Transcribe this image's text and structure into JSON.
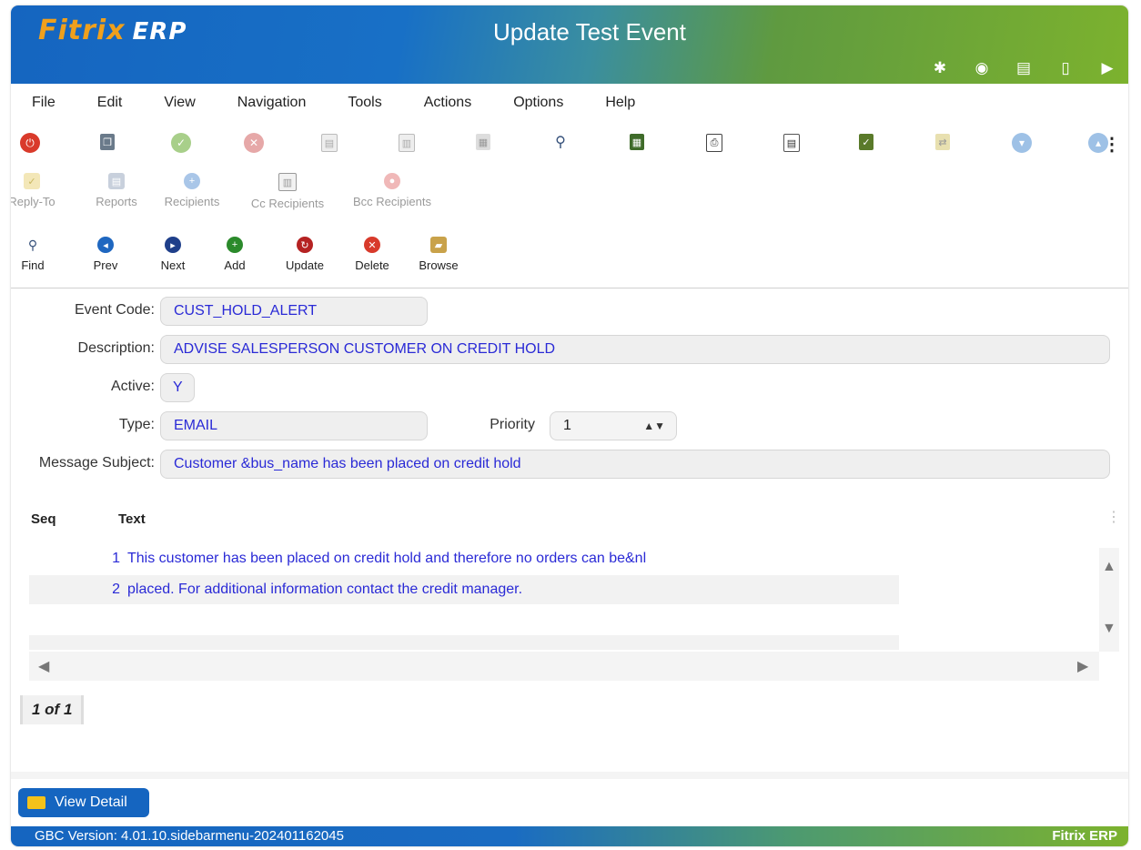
{
  "app": {
    "logo_text_a": "Fitrix",
    "logo_text_b": "ERP",
    "window_title": "Update Test Event",
    "title_icons": [
      "gear-icon",
      "chip-icon",
      "document-filled-icon",
      "document-icon",
      "play-icon"
    ]
  },
  "menu": [
    "File",
    "Edit",
    "View",
    "Navigation",
    "Tools",
    "Actions",
    "Options",
    "Help"
  ],
  "toolbar_icons": [
    "power-icon",
    "copy-icon",
    "accept-icon",
    "cancel-icon",
    "paste-icon",
    "duplicate-icon",
    "barcode-icon",
    "zoom-icon",
    "calendar-icon",
    "attach-icon",
    "note-icon",
    "checklist-icon",
    "transfer-icon",
    "down-icon",
    "up-icon",
    "export-icon"
  ],
  "secondary_toolbar": {
    "reply_to": "Reply-To",
    "reports": "Reports",
    "recipients": "Recipients",
    "cc_recipients": "Cc Recipients",
    "bcc_recipients": "Bcc Recipients"
  },
  "nav_toolbar": {
    "find": "Find",
    "prev": "Prev",
    "next": "Next",
    "add": "Add",
    "update": "Update",
    "delete": "Delete",
    "browse": "Browse"
  },
  "form": {
    "event_code_label": "Event Code:",
    "event_code": "CUST_HOLD_ALERT",
    "description_label": "Description:",
    "description": "ADVISE SALESPERSON CUSTOMER ON CREDIT HOLD",
    "active_label": "Active:",
    "active": "Y",
    "type_label": "Type:",
    "type": "EMAIL",
    "priority_label": "Priority",
    "priority": "1",
    "subject_label": "Message Subject:",
    "subject": "Customer &bus_name has been placed on credit hold"
  },
  "grid": {
    "headers": {
      "seq": "Seq",
      "text": "Text"
    },
    "rows": [
      {
        "seq": "1",
        "text": "This customer has been placed on credit hold and therefore no orders can be&nl"
      },
      {
        "seq": "2",
        "text": "placed. For additional information contact the credit manager."
      }
    ]
  },
  "pager": "1 of 1",
  "view_detail": "View Detail",
  "status": {
    "version": "GBC Version: 4.01.10.sidebarmenu-202401162045",
    "brand": "Fitrix ERP"
  },
  "colors": {
    "accent_blue": "#1565c0",
    "accent_green": "#7cb22e",
    "value_text": "#2a2ad6"
  }
}
